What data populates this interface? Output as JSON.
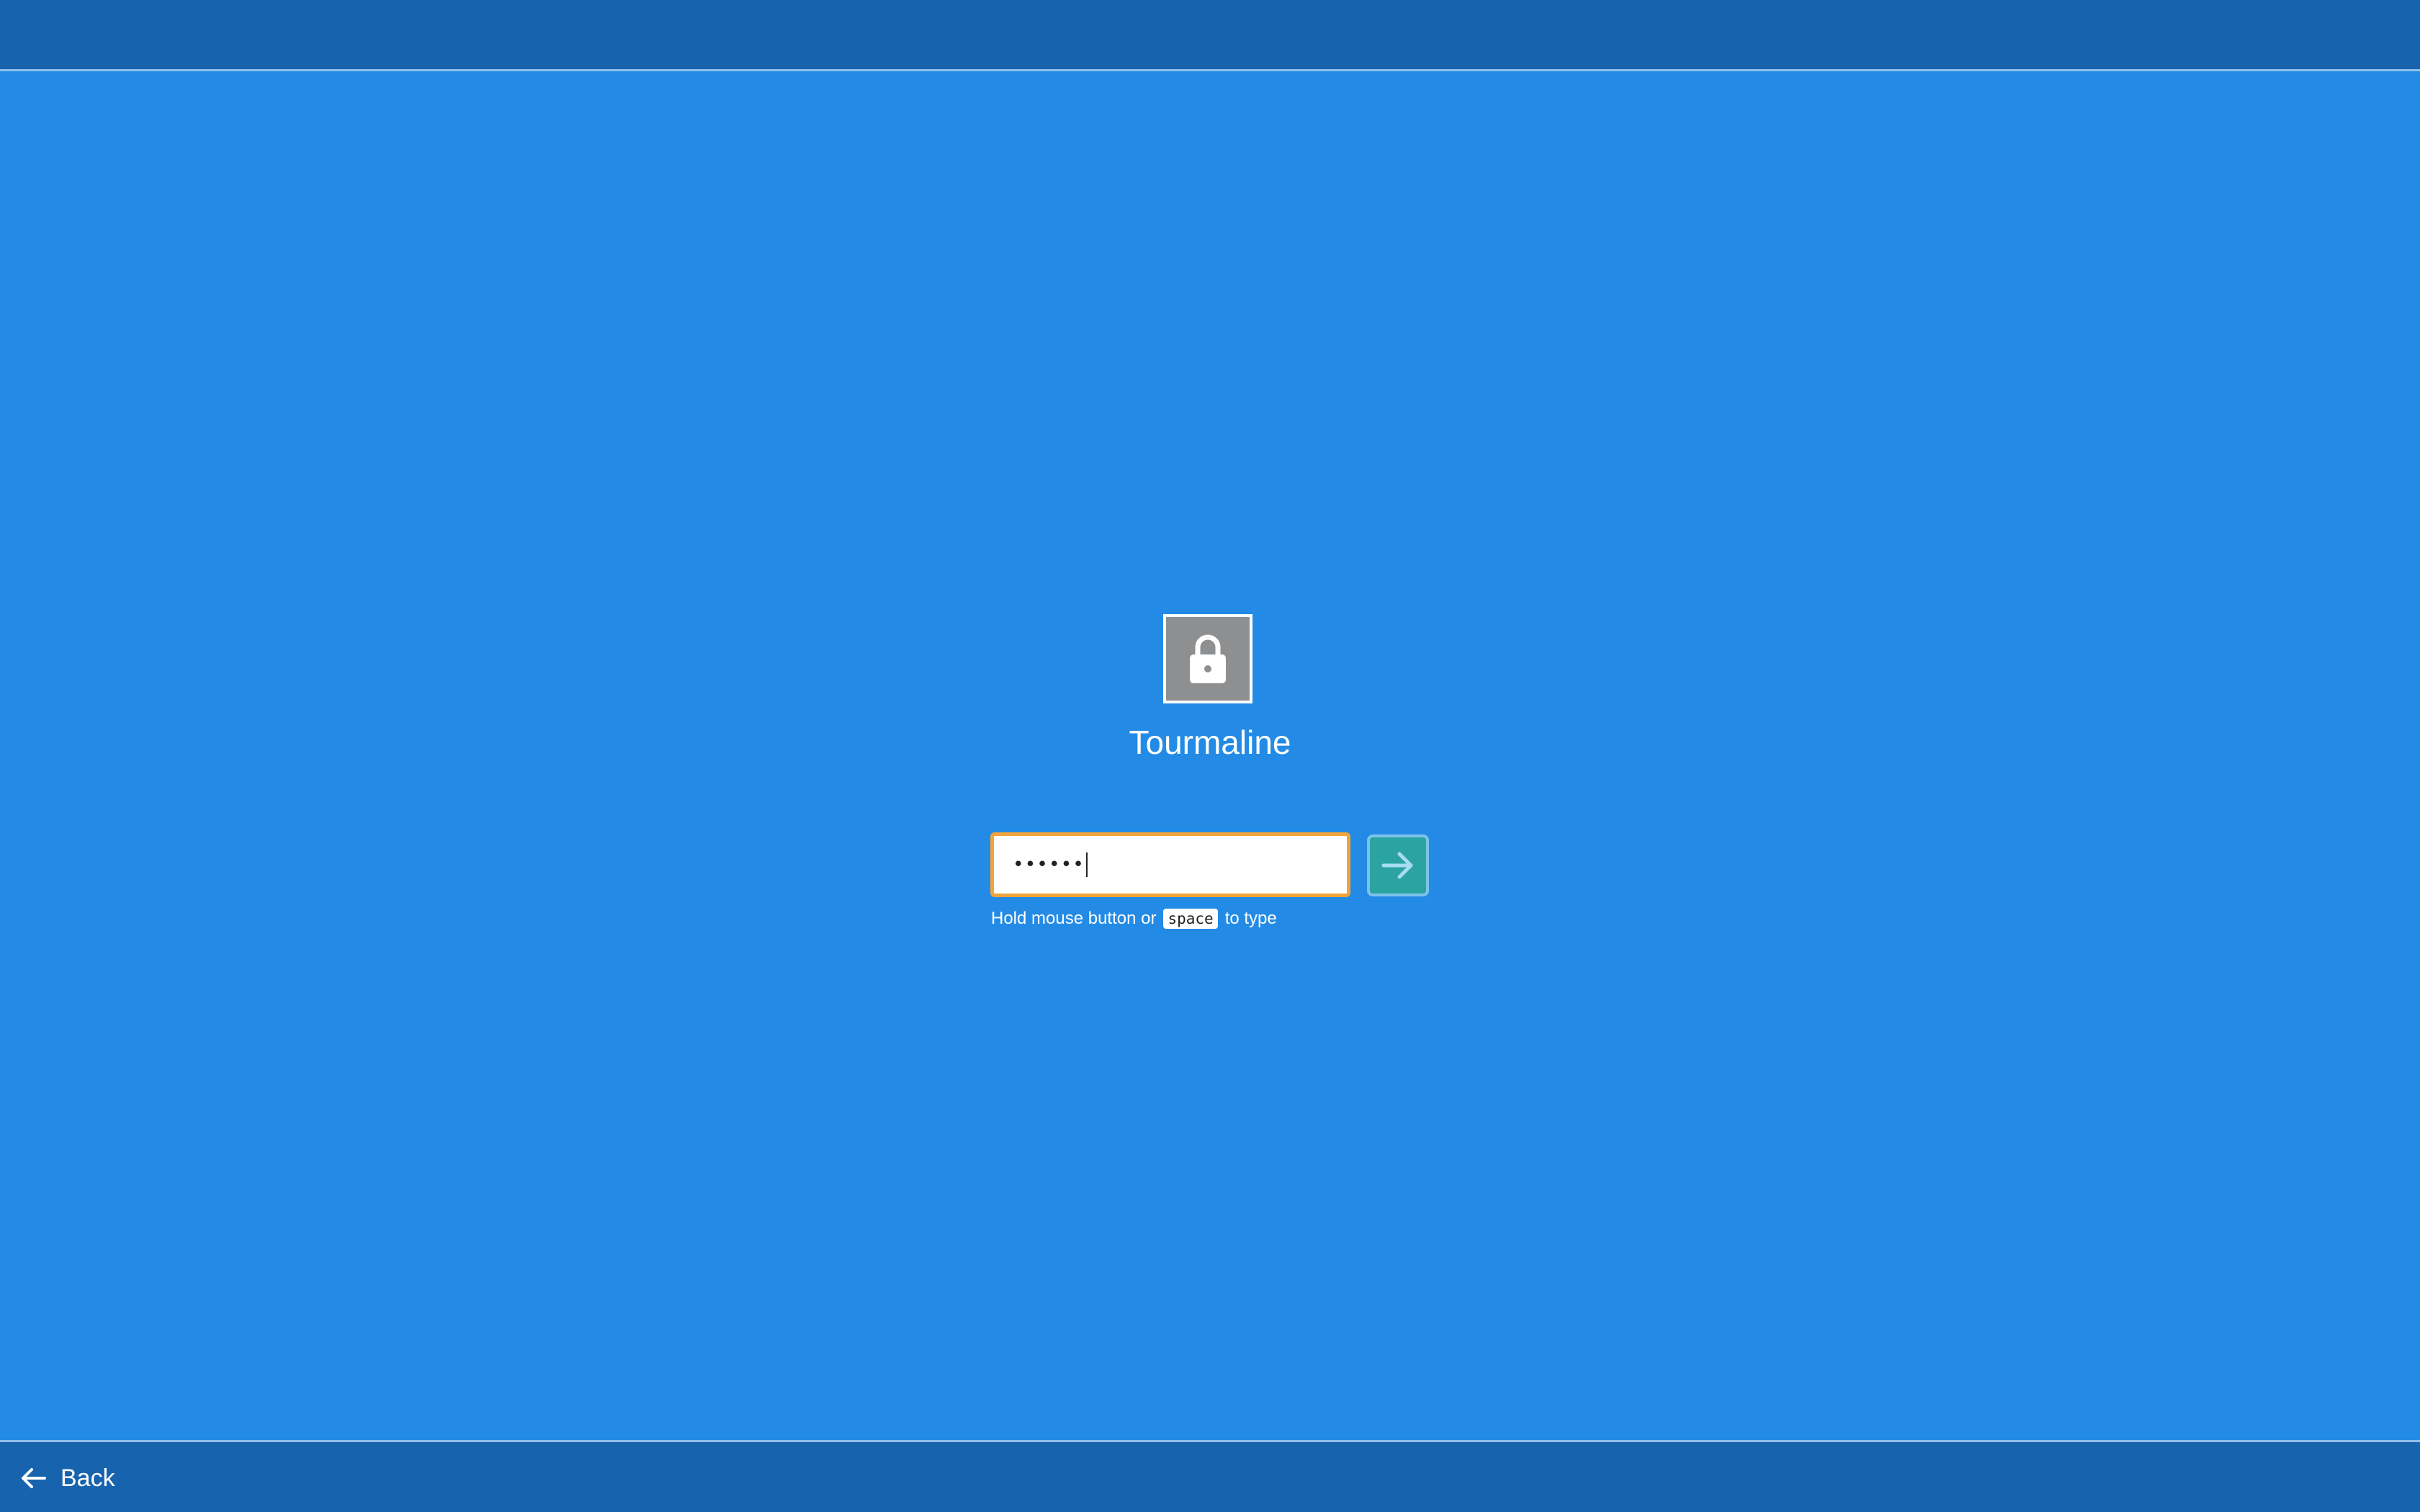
{
  "top_bar": {},
  "profile": {
    "icon": "lock-icon",
    "name": "Tourmaline"
  },
  "password": {
    "masked_value": "••••••"
  },
  "submit": {
    "icon": "arrow-right-icon"
  },
  "hint": {
    "prefix": "Hold mouse button or",
    "key": "space",
    "suffix": "to type"
  },
  "bottom_bar": {
    "back_label": "Back",
    "back_icon": "arrow-left-icon"
  },
  "colors": {
    "background": "#238be6",
    "bars": "#1763ae",
    "focus_border": "#f0a43a",
    "submit_button": "#2aa3a1",
    "lock_tile": "#8e8f91"
  }
}
